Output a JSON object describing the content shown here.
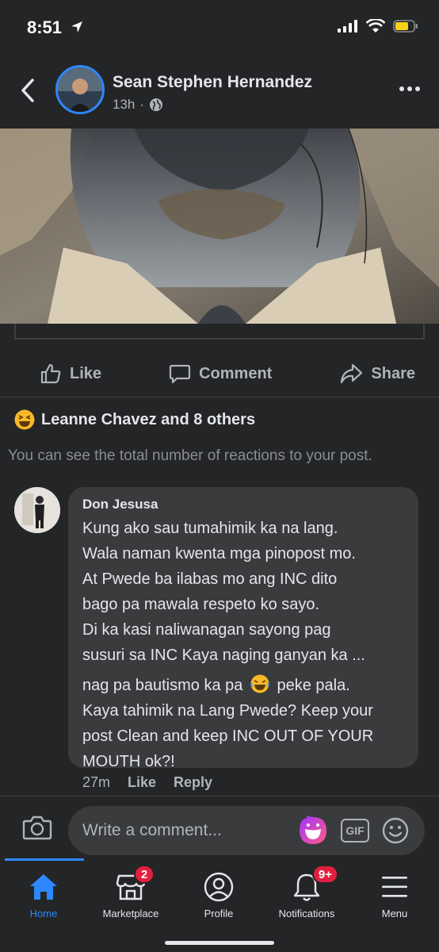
{
  "status": {
    "time": "8:51"
  },
  "post": {
    "author": "Sean Stephen Hernandez",
    "time": "13h",
    "meta_separator": "·"
  },
  "actions": {
    "like": "Like",
    "comment": "Comment",
    "share": "Share"
  },
  "reactions": {
    "summary": "Leanne Chavez and 8 others",
    "note": "You can see the total number of reactions to your post."
  },
  "comment": {
    "author": "Don Jesusa",
    "lines": [
      "Kung ako sau  tumahimik ka na lang.",
      "Wala naman kwenta mga pinopost mo.",
      "At Pwede ba ilabas mo ang INC dito",
      "bago pa mawala respeto ko sayo.",
      "Di ka kasi naliwanagan sayong pag",
      "susuri sa INC Kaya naging ganyan ka ...",
      "nag pa bautismo ka pa",
      "peke pala.",
      "Kaya tahimik na Lang Pwede? Keep your",
      "post Clean and keep INC OUT OF YOUR",
      "MOUTH ok?!"
    ],
    "time": "27m",
    "like": "Like",
    "reply": "Reply"
  },
  "composer": {
    "placeholder": "Write a comment...",
    "gif": "GIF"
  },
  "tabs": {
    "home": "Home",
    "marketplace": "Marketplace",
    "marketplace_badge": "2",
    "profile": "Profile",
    "notifications": "Notifications",
    "notifications_badge": "9+",
    "menu": "Menu"
  },
  "colors": {
    "accent": "#2d88ff",
    "background": "#242526",
    "bubble": "#3a3b3c",
    "badge": "#e41e3f"
  }
}
